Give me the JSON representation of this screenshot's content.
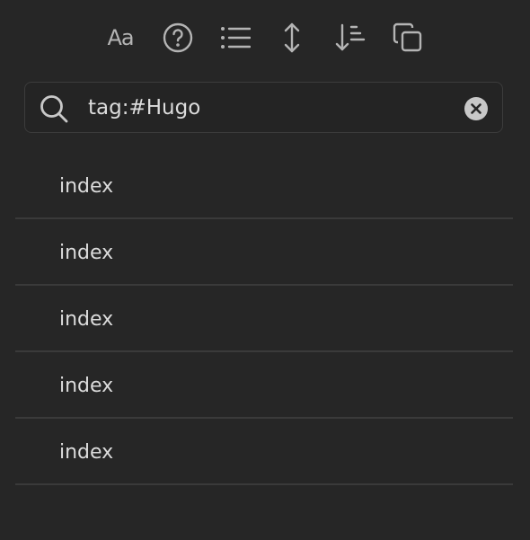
{
  "toolbar": {
    "buttons": [
      {
        "icon": "match-case-icon",
        "glyph": "Aa"
      },
      {
        "icon": "help-circle-icon"
      },
      {
        "icon": "list-icon"
      },
      {
        "icon": "expand-vertical-icon"
      },
      {
        "icon": "sort-icon"
      },
      {
        "icon": "copy-icon"
      }
    ]
  },
  "search": {
    "value": "tag:#Hugo",
    "icon": "search-icon",
    "clear_icon": "close-icon"
  },
  "results": [
    {
      "label": "index"
    },
    {
      "label": "index"
    },
    {
      "label": "index"
    },
    {
      "label": "index"
    },
    {
      "label": "index"
    }
  ],
  "colors": {
    "background": "#262626",
    "text": "#dcdcdc",
    "icon": "#b4b4b4",
    "divider": "#3a3a3a"
  }
}
